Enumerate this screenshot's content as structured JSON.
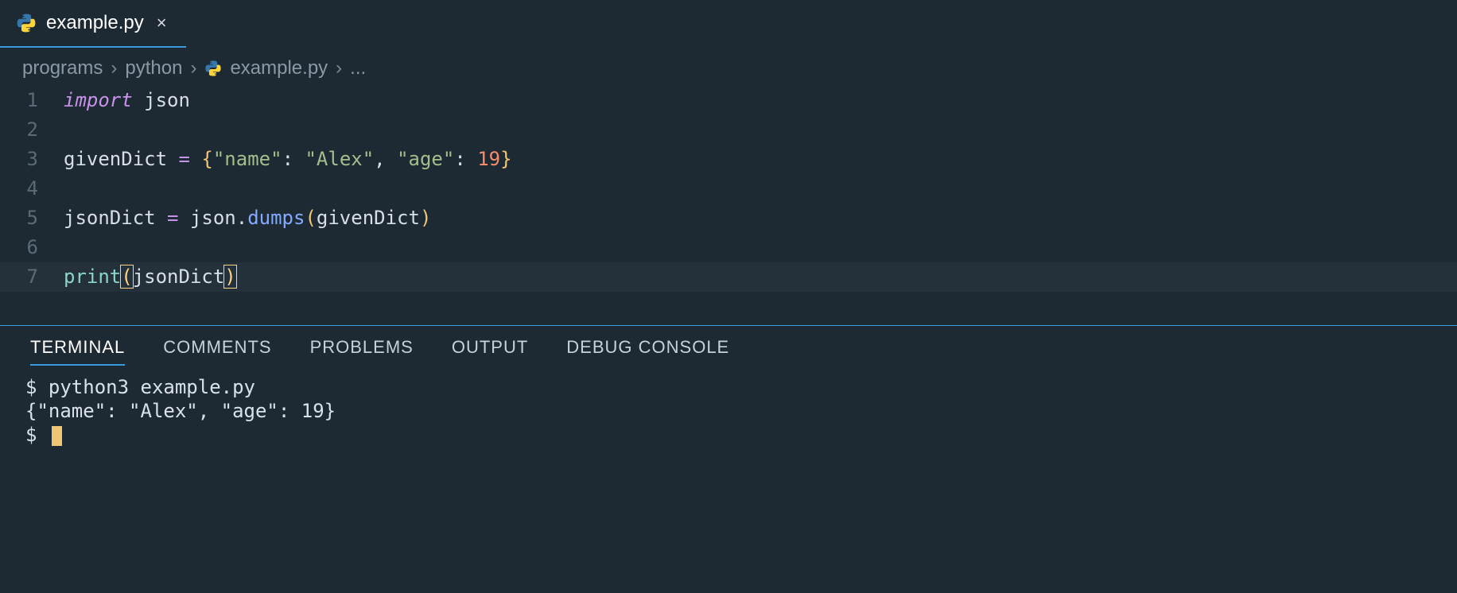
{
  "tab": {
    "filename": "example.py",
    "close_glyph": "×"
  },
  "breadcrumb": {
    "items": [
      "programs",
      "python",
      "example.py",
      "..."
    ],
    "sep": "›"
  },
  "editor": {
    "lines": [
      {
        "n": "1",
        "tokens": [
          {
            "t": "import ",
            "c": "tok-kw"
          },
          {
            "t": "json",
            "c": "tok-var"
          }
        ]
      },
      {
        "n": "2",
        "tokens": []
      },
      {
        "n": "3",
        "tokens": [
          {
            "t": "givenDict ",
            "c": "tok-var"
          },
          {
            "t": "= ",
            "c": "tok-op"
          },
          {
            "t": "{",
            "c": "tok-brace"
          },
          {
            "t": "\"name\"",
            "c": "tok-str"
          },
          {
            "t": ": ",
            "c": "tok-var"
          },
          {
            "t": "\"Alex\"",
            "c": "tok-str"
          },
          {
            "t": ", ",
            "c": "tok-var"
          },
          {
            "t": "\"age\"",
            "c": "tok-str"
          },
          {
            "t": ": ",
            "c": "tok-var"
          },
          {
            "t": "19",
            "c": "tok-num"
          },
          {
            "t": "}",
            "c": "tok-brace"
          }
        ]
      },
      {
        "n": "4",
        "tokens": []
      },
      {
        "n": "5",
        "tokens": [
          {
            "t": "jsonDict ",
            "c": "tok-var"
          },
          {
            "t": "= ",
            "c": "tok-op"
          },
          {
            "t": "json",
            "c": "tok-var"
          },
          {
            "t": ".",
            "c": "tok-var"
          },
          {
            "t": "dumps",
            "c": "tok-fn"
          },
          {
            "t": "(",
            "c": "tok-paren"
          },
          {
            "t": "givenDict",
            "c": "tok-var"
          },
          {
            "t": ")",
            "c": "tok-paren"
          }
        ]
      },
      {
        "n": "6",
        "tokens": []
      },
      {
        "n": "7",
        "active": true,
        "tokens": [
          {
            "t": "print",
            "c": "tok-call"
          },
          {
            "t": "(",
            "c": "tok-bracket"
          },
          {
            "t": "jsonDict",
            "c": "tok-var"
          },
          {
            "t": ")",
            "c": "tok-bracket"
          }
        ]
      }
    ]
  },
  "panel": {
    "tabs": [
      "TERMINAL",
      "COMMENTS",
      "PROBLEMS",
      "OUTPUT",
      "DEBUG CONSOLE"
    ],
    "active": 0
  },
  "terminal": {
    "lines": [
      "$ python3 example.py",
      "{\"name\": \"Alex\", \"age\": 19}",
      "$ "
    ]
  }
}
